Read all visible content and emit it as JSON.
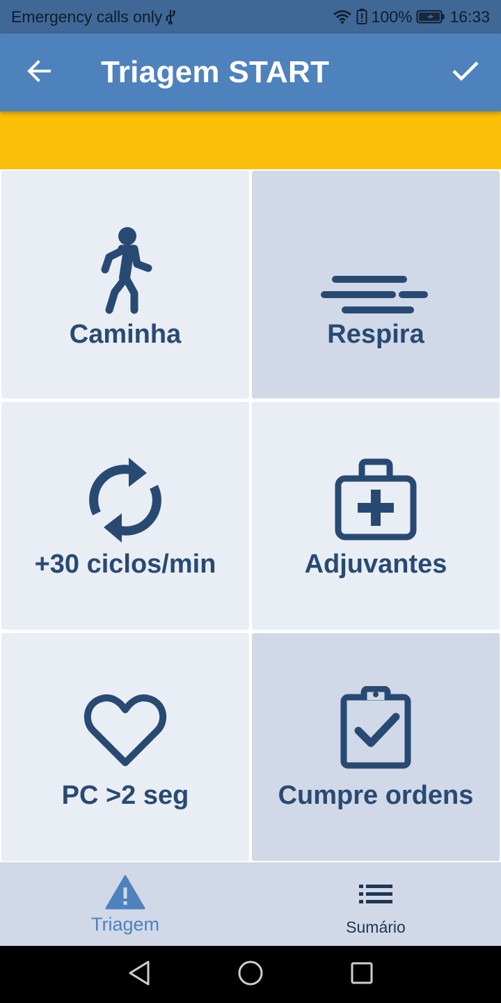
{
  "status_bar": {
    "carrier_text": "Emergency calls only",
    "battery_percent": "100%",
    "time": "16:33"
  },
  "app_bar": {
    "title": "Triagem START",
    "back_icon": "arrow-left-icon",
    "confirm_icon": "check-icon"
  },
  "colors": {
    "app_bar": "#4e82bd",
    "status_bar": "#3f6896",
    "banner": "#fbbf0a",
    "tile_light": "#e9edf4",
    "tile_dark": "#d1d8e7",
    "icon_dark": "#284a72",
    "nav_active": "#4e82bd"
  },
  "tiles": [
    {
      "label": "Caminha",
      "icon": "walking-person-icon",
      "selected": false
    },
    {
      "label": "Respira",
      "icon": "wind-icon",
      "selected": true
    },
    {
      "label": "+30 ciclos/min",
      "icon": "sync-icon",
      "selected": false
    },
    {
      "label": "Adjuvantes",
      "icon": "medical-kit-icon",
      "selected": false
    },
    {
      "label": "PC >2 seg",
      "icon": "heart-icon",
      "selected": false
    },
    {
      "label": "Cumpre ordens",
      "icon": "clipboard-check-icon",
      "selected": true
    }
  ],
  "bottom_nav": {
    "items": [
      {
        "label": "Triagem",
        "icon": "warning-icon",
        "active": true
      },
      {
        "label": "Sumário",
        "icon": "list-icon",
        "active": false
      }
    ]
  }
}
